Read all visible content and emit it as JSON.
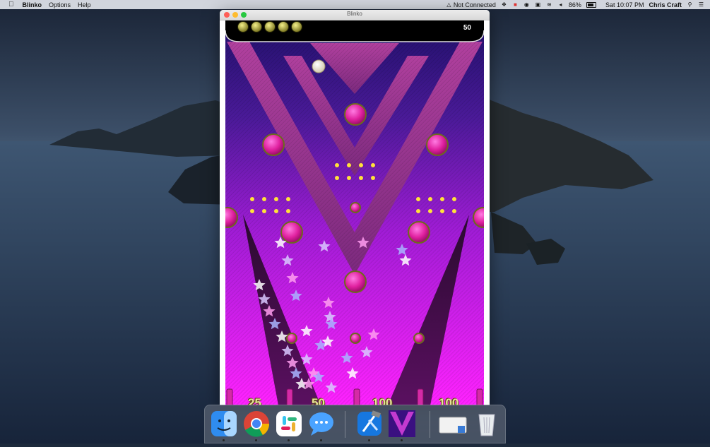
{
  "menubar": {
    "app_name": "Blinko",
    "menus": [
      "Options",
      "Help"
    ],
    "status": {
      "network": "Not Connected",
      "battery": "86%",
      "clock": "Sat 10:07 PM",
      "user": "Chris Craft"
    }
  },
  "window": {
    "title": "Blinko"
  },
  "game": {
    "score": "50",
    "balls_remaining": 5,
    "slot_values": [
      "25",
      "50",
      "100",
      "100"
    ]
  },
  "dock": {
    "items": [
      "finder-icon",
      "chrome-icon",
      "slack-icon",
      "messages-icon",
      "xcode-icon",
      "blinko-icon",
      "document-icon",
      "trash-icon"
    ]
  },
  "colors": {
    "board_top": "#3a1a86",
    "board_bottom": "#ff1fff",
    "peg": "#e0219f",
    "ball": "#f1ead6"
  }
}
